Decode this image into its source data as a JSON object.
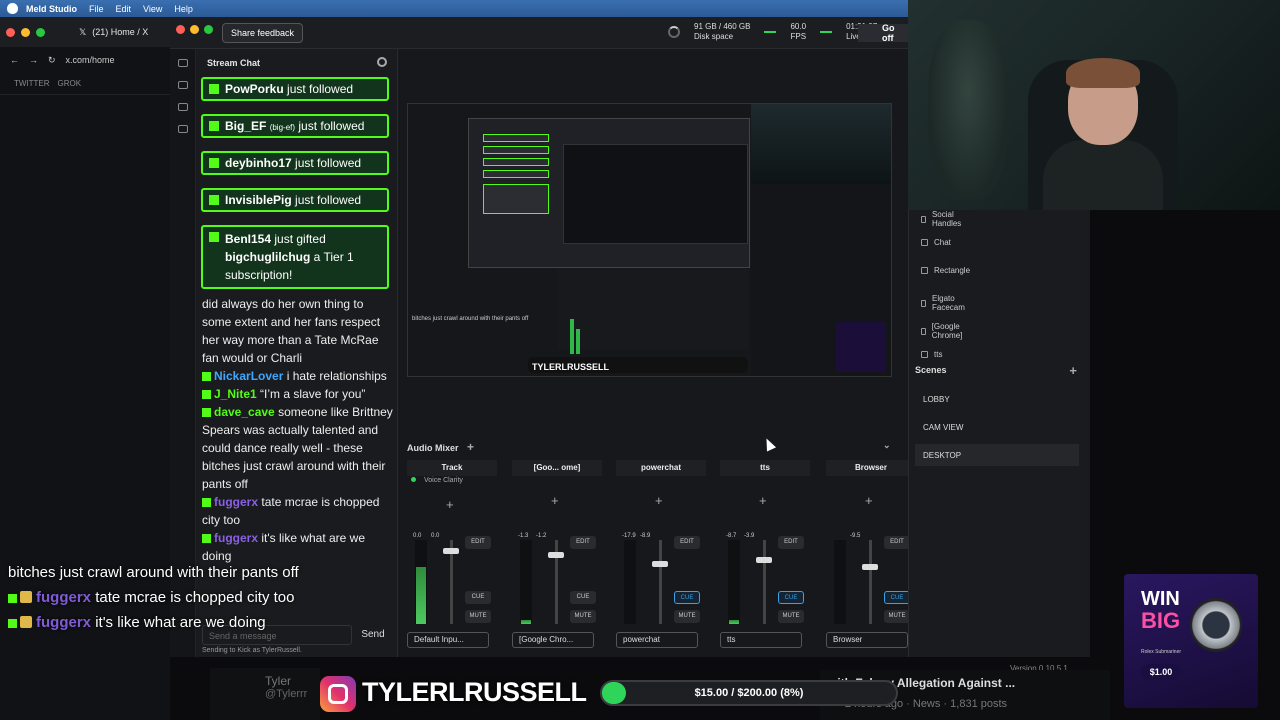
{
  "menubar": {
    "app": "Meld Studio",
    "items": [
      "File",
      "Edit",
      "View",
      "Help"
    ]
  },
  "browser": {
    "tab_title": "(21) Home / X",
    "url": "x.com/home",
    "bookmarks": [
      "TWITTER",
      "GROK"
    ]
  },
  "meld": {
    "feedback_button": "Share feedback",
    "disk_usage": "91 GB / 460 GB",
    "disk_label": "Disk space",
    "fps_value": "60.0",
    "fps_label": "FPS",
    "live_time": "01:21:07",
    "live_label": "Live",
    "go_off": "Go off"
  },
  "chat": {
    "title": "Stream Chat",
    "follows": [
      {
        "user": "PowPorku",
        "action": "just followed"
      },
      {
        "user": "Big_EF",
        "suffix": "(big-ef)",
        "action": "just followed"
      },
      {
        "user": "deybinho17",
        "action": "just followed"
      },
      {
        "user": "InvisiblePig",
        "action": "just followed"
      }
    ],
    "gift": {
      "user": "BenI154",
      "action": "just gifted",
      "recipient": "bigchuglilchug",
      "rest": "a Tier 1 subscription!"
    },
    "messages": [
      {
        "user": "",
        "text": "did always do her own thing to some extent and her fans respect her way more than a Tate McRae fan would or Charli",
        "color": "#eeeeee"
      },
      {
        "user": "NickarLover",
        "text": "i hate relationships",
        "color": "#3ea7ff"
      },
      {
        "user": "J_Nite1",
        "text": "“I’m a slave for you”",
        "color": "#53fc18"
      },
      {
        "user": "dave_cave",
        "text": "someone like Brittney Spears was actually talented and could dance really well - these bitches just crawl around with their pants off",
        "color": "#53fc18"
      },
      {
        "user": "fuggerx",
        "text": "tate mcrae is chopped city too",
        "color": "#8a60e6"
      },
      {
        "user": "fuggerx",
        "text": "it's like what are we doing",
        "color": "#8a60e6"
      }
    ],
    "input_placeholder": "Send a message",
    "send_label": "Send",
    "sending_as": "Sending to Kick as TylerRussell."
  },
  "mixer": {
    "title": "Audio Mixer",
    "tracks": [
      {
        "name": "Track",
        "level_left": "0.0",
        "level_right": "0.0",
        "source": "Default Inpu...",
        "cue_active": false,
        "fill": 0.68,
        "knob": 0.1,
        "effect": "Voice Clarity"
      },
      {
        "name": "[Goo... ome]",
        "level_left": "-1.3",
        "level_right": "-1.2",
        "source": "[Google Chro...",
        "cue_active": false,
        "fill": 0.05,
        "knob": 0.14,
        "effect": ""
      },
      {
        "name": "powerchat",
        "level_left": "-17.9",
        "level_right": "-8.9",
        "source": "powerchat",
        "cue_active": true,
        "fill": 0.0,
        "knob": 0.25,
        "effect": ""
      },
      {
        "name": "tts",
        "level_left": "-8.7",
        "level_right": "-3.9",
        "source": "tts",
        "cue_active": true,
        "fill": 0.05,
        "knob": 0.2,
        "effect": ""
      },
      {
        "name": "Browser",
        "level_left": "",
        "level_right": "-9.5",
        "source": "Browser",
        "cue_active": true,
        "fill": 0.0,
        "knob": 0.28,
        "effect": ""
      }
    ],
    "buttons": {
      "edit": "EDIT",
      "cue": "CUE",
      "mute": "MUTE"
    }
  },
  "layers": [
    "Social Handles",
    "Chat",
    "Rectangle",
    "Elgato Facecam",
    "[Google Chrome]",
    "tts"
  ],
  "scenes": {
    "title": "Scenes",
    "items": [
      "LOBBY",
      "CAM VIEW",
      "DESKTOP"
    ],
    "active": "DESKTOP"
  },
  "version": "Version 0.10.5.1",
  "overlay": {
    "chat_lines": [
      {
        "user": "",
        "text": "bitches just crawl around with their pants off"
      },
      {
        "user": "fuggerx",
        "text": "tate mcrae is chopped city too"
      },
      {
        "user": "fuggerx",
        "text": "it's like what are we doing"
      }
    ],
    "handle": "TYLERLRUSSELL",
    "goal_text": "$15.00 / $200.00 (8%)",
    "goal_progress": 0.08,
    "tyler_name": "Tyler",
    "tyler_at": "@Tylerrr",
    "news_title": "with Felony Allegation Against ...",
    "news_meta": "2 hours ago · News · 1,831 posts",
    "ad": {
      "win": "WIN",
      "big": "BIG",
      "sub": "Rolex Submariner",
      "price": "$1.00"
    }
  },
  "colors": {
    "kick_green": "#53fc18",
    "cue_blue": "#3aa0e8",
    "accent_pink": "#ff4fa3"
  }
}
